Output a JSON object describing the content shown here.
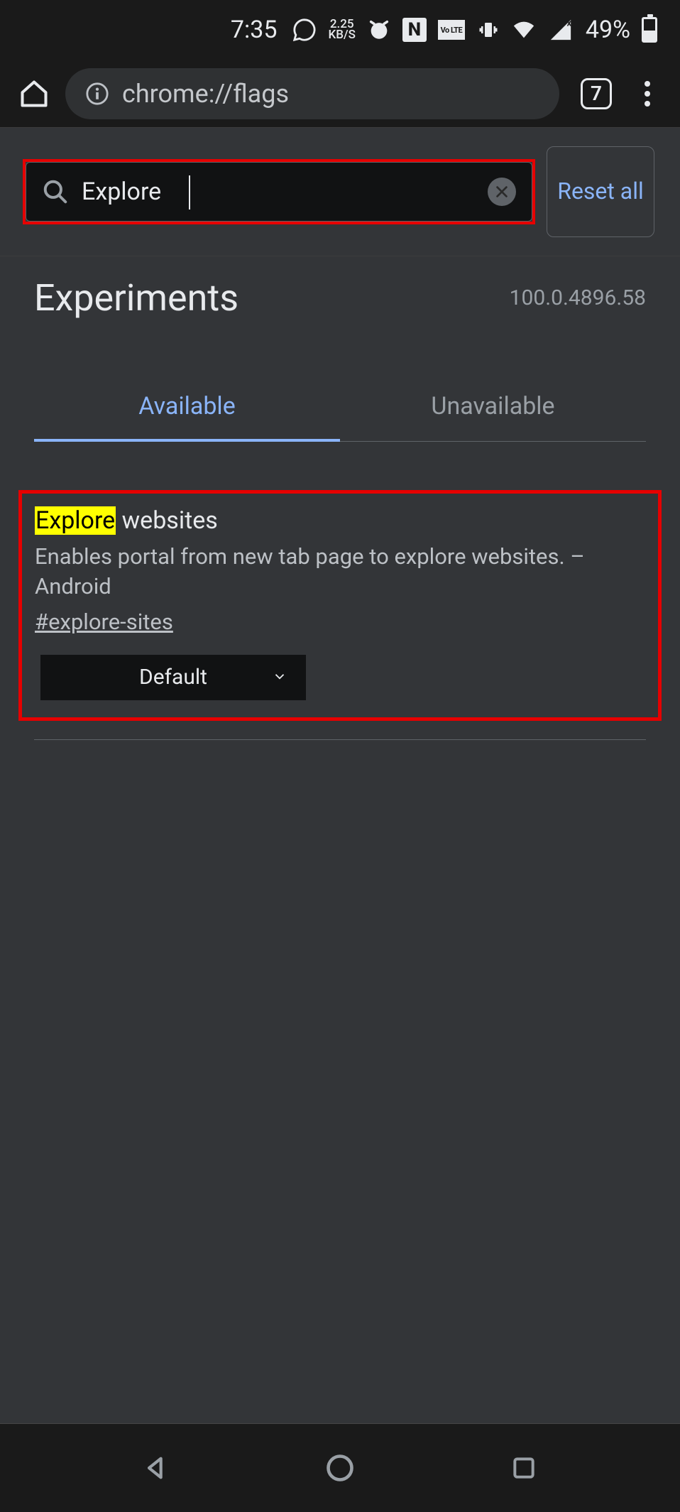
{
  "status": {
    "time": "7:35",
    "kbs_top": "2.25",
    "kbs_bottom": "KB/S",
    "volte": "Vo LTE",
    "battery_pct": "49%"
  },
  "browser": {
    "url": "chrome://flags",
    "tab_count": "7"
  },
  "search": {
    "value": "Explore",
    "reset_label": "Reset all"
  },
  "page": {
    "title": "Experiments",
    "version": "100.0.4896.58"
  },
  "tabs": {
    "available": "Available",
    "unavailable": "Unavailable"
  },
  "flag": {
    "title_hl": "Explore",
    "title_rest": " websites",
    "desc": "Enables portal from new tab page to explore websites. – Android",
    "anchor": "#explore-sites",
    "dropdown": "Default"
  }
}
